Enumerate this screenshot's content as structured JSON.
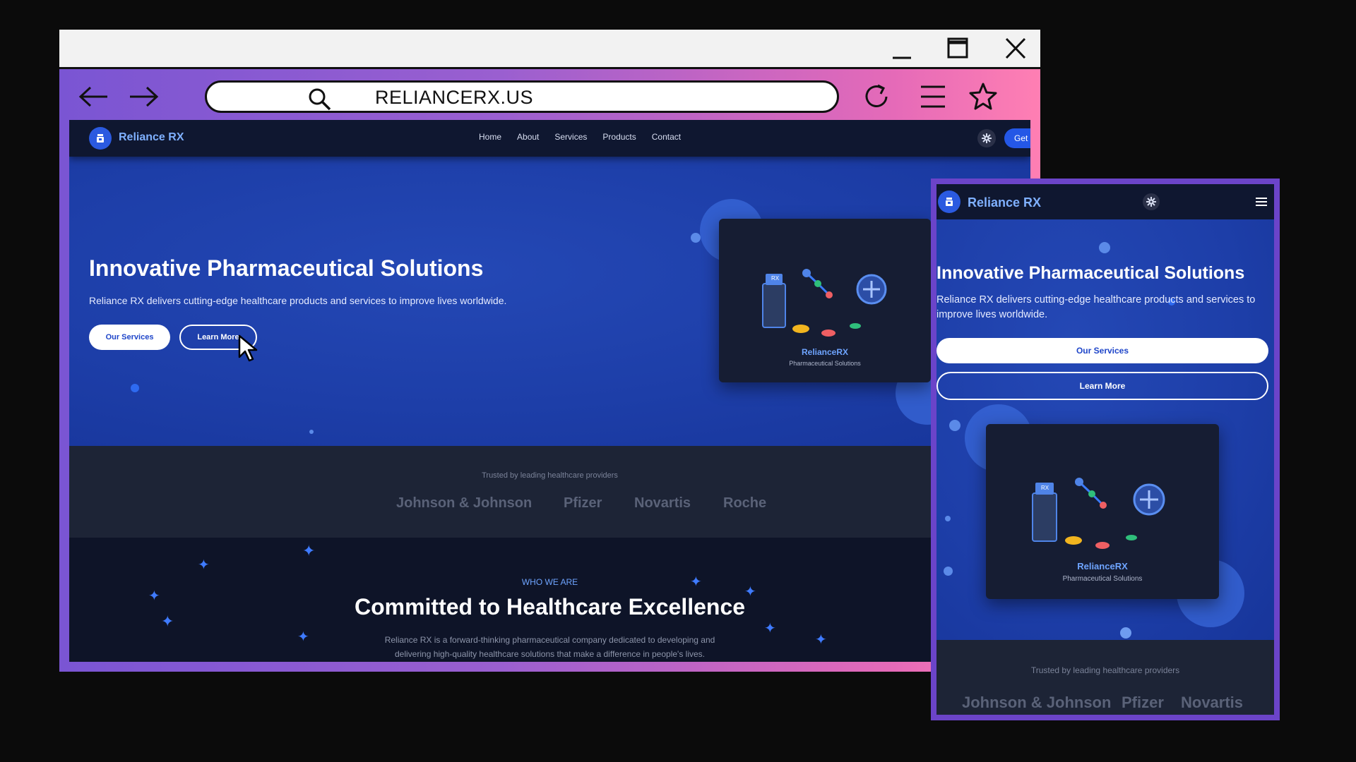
{
  "browser": {
    "url": "RELIANCERX.US",
    "accent_gradient": [
      "#7a55d3",
      "#ff7fb3"
    ]
  },
  "site": {
    "brand": "Reliance RX",
    "nav": [
      "Home",
      "About",
      "Services",
      "Products",
      "Contact"
    ],
    "cta_partial": "Get",
    "hero": {
      "title": "Innovative Pharmaceutical Solutions",
      "subtitle": "Reliance RX delivers cutting-edge healthcare products and services to improve lives worldwide.",
      "primary_button": "Our Services",
      "secondary_button": "Learn More"
    },
    "card": {
      "vial_label": "RX",
      "brand": "RelianceRX",
      "tagline": "Pharmaceutical Solutions"
    },
    "trust": {
      "label": "Trusted by leading healthcare providers",
      "partners": [
        "Johnson & Johnson",
        "Pfizer",
        "Novartis",
        "Roche"
      ]
    },
    "about": {
      "kicker": "WHO WE ARE",
      "title": "Committed to Healthcare Excellence",
      "text_line1": "Reliance RX is a forward-thinking pharmaceutical company dedicated to developing and",
      "text_line2": "delivering high-quality healthcare solutions that make a difference in people's lives."
    }
  },
  "mobile": {
    "brand": "Reliance RX",
    "hero": {
      "title": "Innovative Pharmaceutical Solutions",
      "subtitle": "Reliance RX delivers cutting-edge healthcare products and services to improve lives worldwide.",
      "primary_button": "Our Services",
      "secondary_button": "Learn More"
    },
    "card": {
      "vial_label": "RX",
      "brand": "RelianceRX",
      "tagline": "Pharmaceutical Solutions"
    },
    "trust": {
      "label": "Trusted by leading healthcare providers",
      "partners": [
        "Johnson & Johnson",
        "Pfizer",
        "Novartis"
      ]
    }
  }
}
